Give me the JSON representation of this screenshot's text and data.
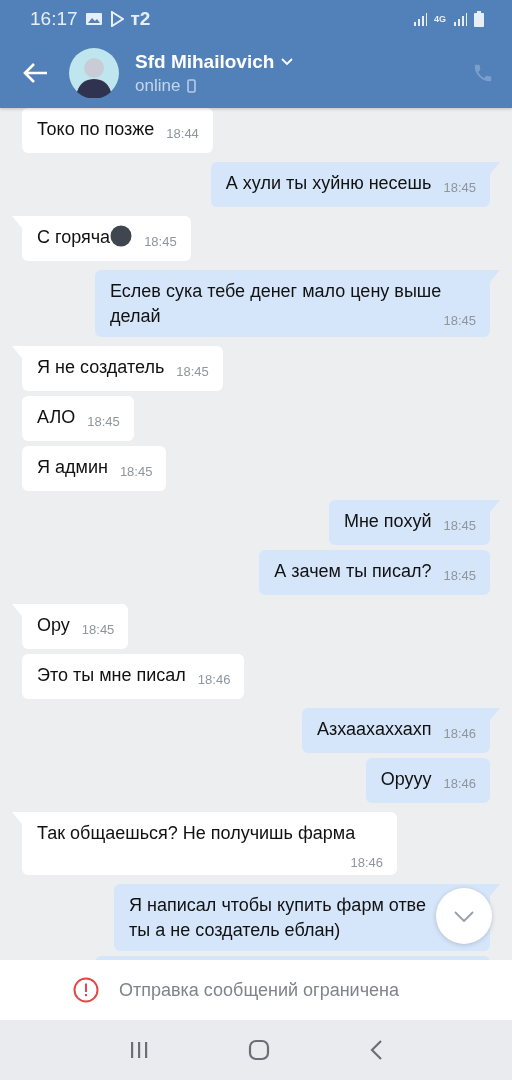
{
  "status_bar": {
    "time": "16:17",
    "carrier": "т2",
    "network_type": "4G"
  },
  "header": {
    "name": "Sfd Mihailovich",
    "status": "online"
  },
  "messages": [
    {
      "outgoing": false,
      "text": "Токо по позже",
      "time": "18:44"
    },
    {
      "outgoing": true,
      "text": "А хули ты хуйню несешь",
      "time": "18:45"
    },
    {
      "outgoing": false,
      "text": "С горяча",
      "emoji_icon": true,
      "time": "18:45"
    },
    {
      "outgoing": true,
      "text": "Еслев сука тебе денег мало цену выше делай",
      "time": "18:45"
    },
    {
      "outgoing": false,
      "text": "Я не создатель",
      "time": "18:45"
    },
    {
      "outgoing": false,
      "text": "АЛО",
      "time": "18:45"
    },
    {
      "outgoing": false,
      "text": "Я админ",
      "time": "18:45"
    },
    {
      "outgoing": true,
      "text": "Мне похуй",
      "time": "18:45"
    },
    {
      "outgoing": true,
      "text": "А зачем ты писал?",
      "time": "18:45"
    },
    {
      "outgoing": false,
      "text": "Ору",
      "time": "18:45"
    },
    {
      "outgoing": false,
      "text": "Это ты мне писал",
      "time": "18:46"
    },
    {
      "outgoing": true,
      "text": "Азхаахаххахп",
      "time": "18:46"
    },
    {
      "outgoing": true,
      "text": "Орууу",
      "time": "18:46"
    },
    {
      "outgoing": false,
      "text": "Так общаешься? Не получишь фарма",
      "time": "18:46"
    },
    {
      "outgoing": true,
      "text": "Я написал чтобы купить фарм отве\nты а не создатель еблан)"
    },
    {
      "outgoing": true
    }
  ],
  "notice": "Отправка сообщений ограничена"
}
